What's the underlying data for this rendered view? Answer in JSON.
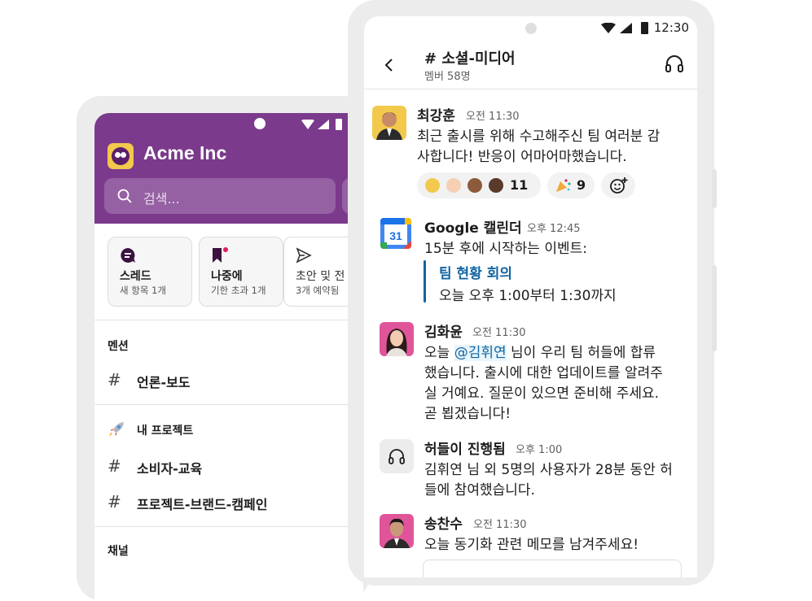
{
  "left": {
    "workspace_name": "Acme Inc",
    "search_placeholder": "검색...",
    "cards": [
      {
        "title": "스레드",
        "sub": "새 항목 1개"
      },
      {
        "title": "나중에",
        "sub": "기한 초과 1개"
      },
      {
        "title": "초안 및 전",
        "sub": "3개 예약됨"
      }
    ],
    "section_mentions": "멘션",
    "channel_mention": "언론-보도",
    "section_projects": "내 프로젝트",
    "project_channels": [
      "소비자-교육",
      "프로젝트-브랜드-캠페인"
    ],
    "section_channels": "채널",
    "hash": "#"
  },
  "right": {
    "clock": "12:30",
    "channel_title": "# 소셜-미디어",
    "channel_members": "멤버 58명",
    "messages": [
      {
        "sender": "최강훈",
        "time": "오전 11:30",
        "lines": [
          "최근 출시를 위해 수고해주신 팀 여러분 감",
          "사합니다! 반응이 어마어마했습니다."
        ],
        "reactions": [
          {
            "count": "11"
          },
          {
            "count": "9"
          }
        ]
      },
      {
        "sender": "Google 캘린더",
        "time": "오후 12:45",
        "lines": [
          "15분 후에 시작하는 이벤트:"
        ],
        "event_title": "팀 현황 회의",
        "event_time": "오늘 오후 1:00부터 1:30까지",
        "calendar_day": "31"
      },
      {
        "sender": "김화윤",
        "time": "오전 11:30",
        "line1_pre": "오늘 ",
        "mention": "@김휘연",
        "line1_post": " 님이 우리 팀 허들에 합류",
        "lines": [
          "했습니다. 출시에 대한 업데이트를 알려주",
          "실 거예요. 질문이 있으면 준비해 주세요.",
          "곧 뵙겠습니다!"
        ]
      },
      {
        "sender": "허들이 진행됨",
        "time": "오후 1:00",
        "lines": [
          "김휘연 님 외 5명의 사용자가 28분 동안 허",
          "들에 참여했습니다."
        ]
      },
      {
        "sender": "송찬수",
        "time": "오전 11:30",
        "lines": [
          "오늘 동기화 관련 메모를 남겨주세요!"
        ]
      }
    ]
  },
  "colors": {
    "aubergine": "#7b3a8c",
    "link_blue": "#1264a3",
    "workspace_yellow": "#f2c94c"
  },
  "icons": [
    "search-icon",
    "thread-icon",
    "bookmark-icon",
    "send-icon",
    "rocket-icon",
    "headphones-icon",
    "back-icon",
    "add-reaction-icon",
    "calendar-icon"
  ]
}
